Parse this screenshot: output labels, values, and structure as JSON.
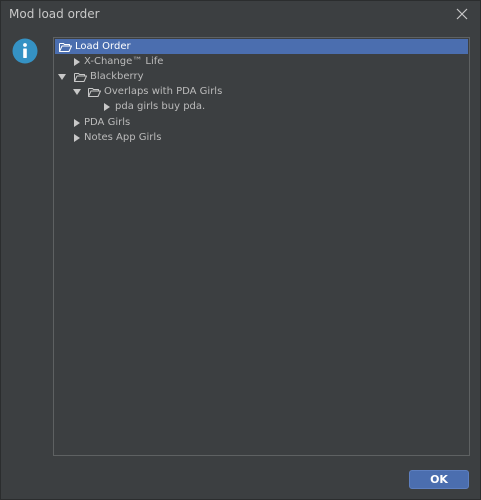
{
  "window": {
    "title": "Mod load order"
  },
  "tree": {
    "items": [
      {
        "label": "Load Order",
        "selected": true,
        "expanded": true,
        "folder": true,
        "arrow": false
      },
      {
        "label": "X-Change™ Life",
        "selected": false,
        "expanded": false,
        "folder": false,
        "arrow": true
      },
      {
        "label": "Blackberry",
        "selected": false,
        "expanded": true,
        "folder": true,
        "arrow": true
      },
      {
        "label": "Overlaps with PDA Girls",
        "selected": false,
        "expanded": true,
        "folder": true,
        "arrow": true
      },
      {
        "label": "pda girls buy pda.",
        "selected": false,
        "expanded": false,
        "folder": false,
        "arrow": true
      },
      {
        "label": "PDA Girls",
        "selected": false,
        "expanded": false,
        "folder": false,
        "arrow": true
      },
      {
        "label": "Notes App Girls",
        "selected": false,
        "expanded": false,
        "folder": false,
        "arrow": true
      }
    ]
  },
  "footer": {
    "ok_label": "OK"
  },
  "icons": {
    "info": "info-icon",
    "close": "close-icon",
    "folder": "folder-open-icon",
    "expanded_arrow": "triangle-down-icon",
    "collapsed_arrow": "triangle-right-icon"
  },
  "colors": {
    "background": "#3c3f41",
    "selection": "#4b6eaf",
    "text": "#bbbbbb",
    "info_icon": "#3592c4"
  }
}
